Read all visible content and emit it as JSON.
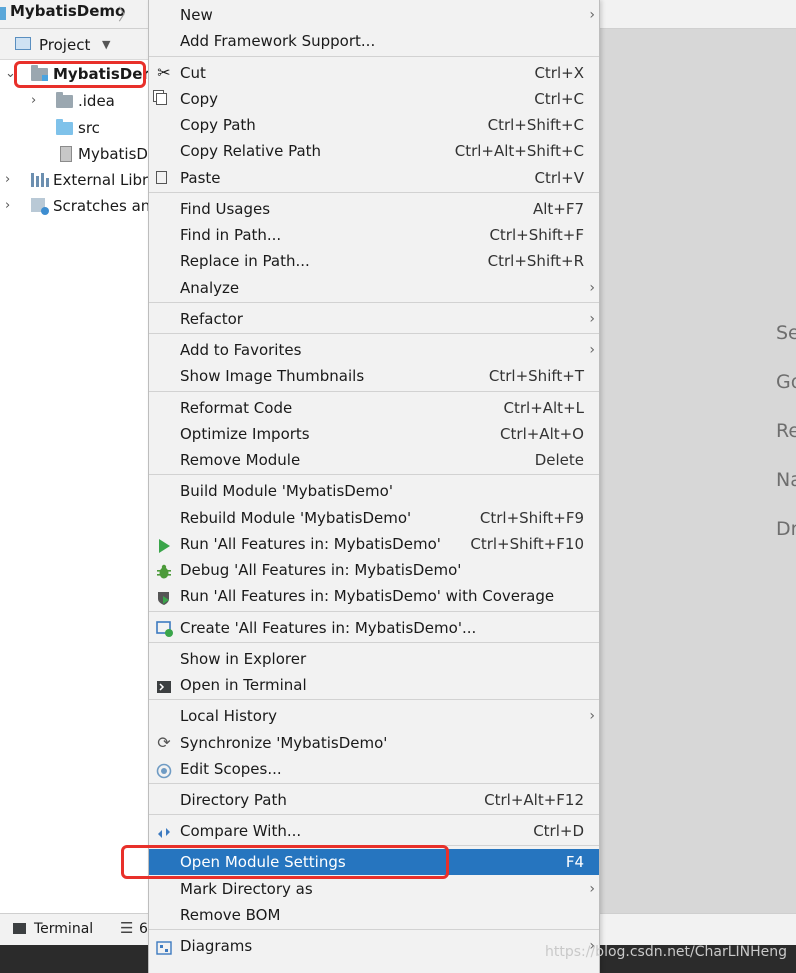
{
  "breadcrumb": {
    "project": "MybatisDemo"
  },
  "project_panel": {
    "header_label": "Project",
    "tree": [
      {
        "label": "MybatisDem",
        "kind": "module"
      },
      {
        "label": ".idea",
        "kind": "folder"
      },
      {
        "label": "src",
        "kind": "source-folder"
      },
      {
        "label": "MybatisD",
        "kind": "file"
      },
      {
        "label": "External Libra",
        "kind": "libraries"
      },
      {
        "label": "Scratches and",
        "kind": "scratches"
      }
    ]
  },
  "editor_hints": [
    "Se",
    "Go",
    "Re",
    "Na",
    "Dr"
  ],
  "bottom_bar": {
    "terminal_label": "Terminal",
    "todo_label": "6"
  },
  "watermark": "https://blog.csdn.net/CharLINHeng",
  "menu": {
    "items": [
      {
        "id": "new",
        "label": "New",
        "submenu": true
      },
      {
        "id": "add-framework",
        "label": "Add Framework Support...",
        "shortcut": ""
      },
      {
        "id": "cut",
        "label": "Cut",
        "shortcut": "Ctrl+X",
        "icon": "scissors-icon"
      },
      {
        "id": "copy",
        "label": "Copy",
        "shortcut": "Ctrl+C",
        "icon": "copy-icon"
      },
      {
        "id": "copy-path",
        "label": "Copy Path",
        "shortcut": "Ctrl+Shift+C"
      },
      {
        "id": "copy-relative-path",
        "label": "Copy Relative Path",
        "shortcut": "Ctrl+Alt+Shift+C"
      },
      {
        "id": "paste",
        "label": "Paste",
        "shortcut": "Ctrl+V",
        "icon": "paste-icon"
      },
      {
        "id": "find-usages",
        "label": "Find Usages",
        "shortcut": "Alt+F7"
      },
      {
        "id": "find-in-path",
        "label": "Find in Path...",
        "shortcut": "Ctrl+Shift+F"
      },
      {
        "id": "replace-in-path",
        "label": "Replace in Path...",
        "shortcut": "Ctrl+Shift+R"
      },
      {
        "id": "analyze",
        "label": "Analyze",
        "submenu": true
      },
      {
        "id": "refactor",
        "label": "Refactor",
        "submenu": true
      },
      {
        "id": "add-to-favorites",
        "label": "Add to Favorites",
        "submenu": true
      },
      {
        "id": "show-image-thumbnails",
        "label": "Show Image Thumbnails",
        "shortcut": "Ctrl+Shift+T"
      },
      {
        "id": "reformat-code",
        "label": "Reformat Code",
        "shortcut": "Ctrl+Alt+L"
      },
      {
        "id": "optimize-imports",
        "label": "Optimize Imports",
        "shortcut": "Ctrl+Alt+O"
      },
      {
        "id": "remove-module",
        "label": "Remove Module",
        "shortcut": "Delete"
      },
      {
        "id": "build-module",
        "label": "Build Module 'MybatisDemo'",
        "shortcut": ""
      },
      {
        "id": "rebuild-module",
        "label": "Rebuild Module 'MybatisDemo'",
        "shortcut": "Ctrl+Shift+F9"
      },
      {
        "id": "run-all",
        "label": "Run 'All Features in: MybatisDemo'",
        "shortcut": "Ctrl+Shift+F10",
        "icon": "run-icon"
      },
      {
        "id": "debug-all",
        "label": "Debug 'All Features in: MybatisDemo'",
        "shortcut": "",
        "icon": "bug-icon"
      },
      {
        "id": "run-coverage",
        "label": "Run 'All Features in: MybatisDemo' with Coverage",
        "shortcut": "",
        "icon": "coverage-icon"
      },
      {
        "id": "create-config",
        "label": "Create 'All Features in: MybatisDemo'...",
        "shortcut": "",
        "icon": "create-config-icon"
      },
      {
        "id": "show-in-explorer",
        "label": "Show in Explorer",
        "shortcut": ""
      },
      {
        "id": "open-in-terminal",
        "label": "Open in Terminal",
        "shortcut": "",
        "icon": "terminal-icon"
      },
      {
        "id": "local-history",
        "label": "Local History",
        "submenu": true
      },
      {
        "id": "synchronize",
        "label": "Synchronize 'MybatisDemo'",
        "shortcut": "",
        "icon": "sync-icon"
      },
      {
        "id": "edit-scopes",
        "label": "Edit Scopes...",
        "shortcut": "",
        "icon": "scope-icon"
      },
      {
        "id": "directory-path",
        "label": "Directory Path",
        "shortcut": "Ctrl+Alt+F12"
      },
      {
        "id": "compare-with",
        "label": "Compare With...",
        "shortcut": "Ctrl+D",
        "icon": "compare-icon"
      },
      {
        "id": "open-module-settings",
        "label": "Open Module Settings",
        "shortcut": "F4",
        "selected": true
      },
      {
        "id": "mark-directory-as",
        "label": "Mark Directory as",
        "submenu": true
      },
      {
        "id": "remove-bom",
        "label": "Remove BOM",
        "shortcut": ""
      },
      {
        "id": "diagrams",
        "label": "Diagrams",
        "submenu": true,
        "icon": "diagram-icon"
      }
    ]
  },
  "colors": {
    "selection": "#2675bf",
    "annotation": "#e8302a",
    "menu_bg": "#f2f2f2",
    "editor_bg": "#d7d7d7"
  }
}
